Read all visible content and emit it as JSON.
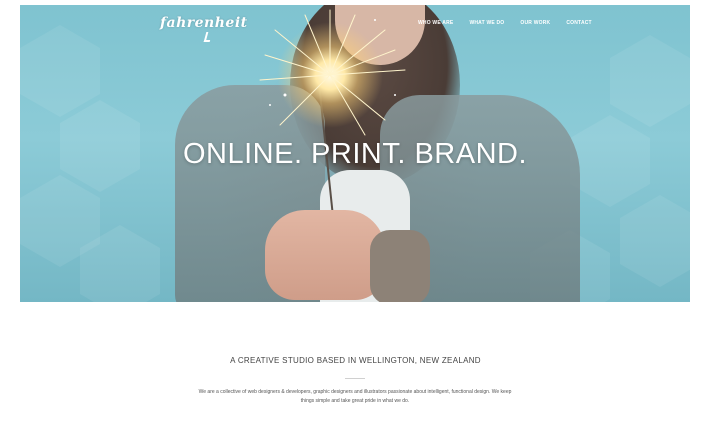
{
  "header": {
    "logo_text": "fahrenheit",
    "nav": [
      {
        "label": "WHO WE ARE"
      },
      {
        "label": "WHAT WE DO"
      },
      {
        "label": "OUR WORK"
      },
      {
        "label": "CONTACT"
      }
    ]
  },
  "hero": {
    "headline": "ONLINE. PRINT. BRAND."
  },
  "intro": {
    "tagline": "A CREATIVE STUDIO BASED IN WELLINGTON, NEW ZEALAND",
    "description": "We are a collective of web designers & developers, graphic designers and illustrators passionate about intelligent, functional design. We keep things simple and take great pride in what we do."
  },
  "colors": {
    "hero_bg": "#8ccbd7",
    "text_white": "#ffffff",
    "body_text": "#444444"
  }
}
